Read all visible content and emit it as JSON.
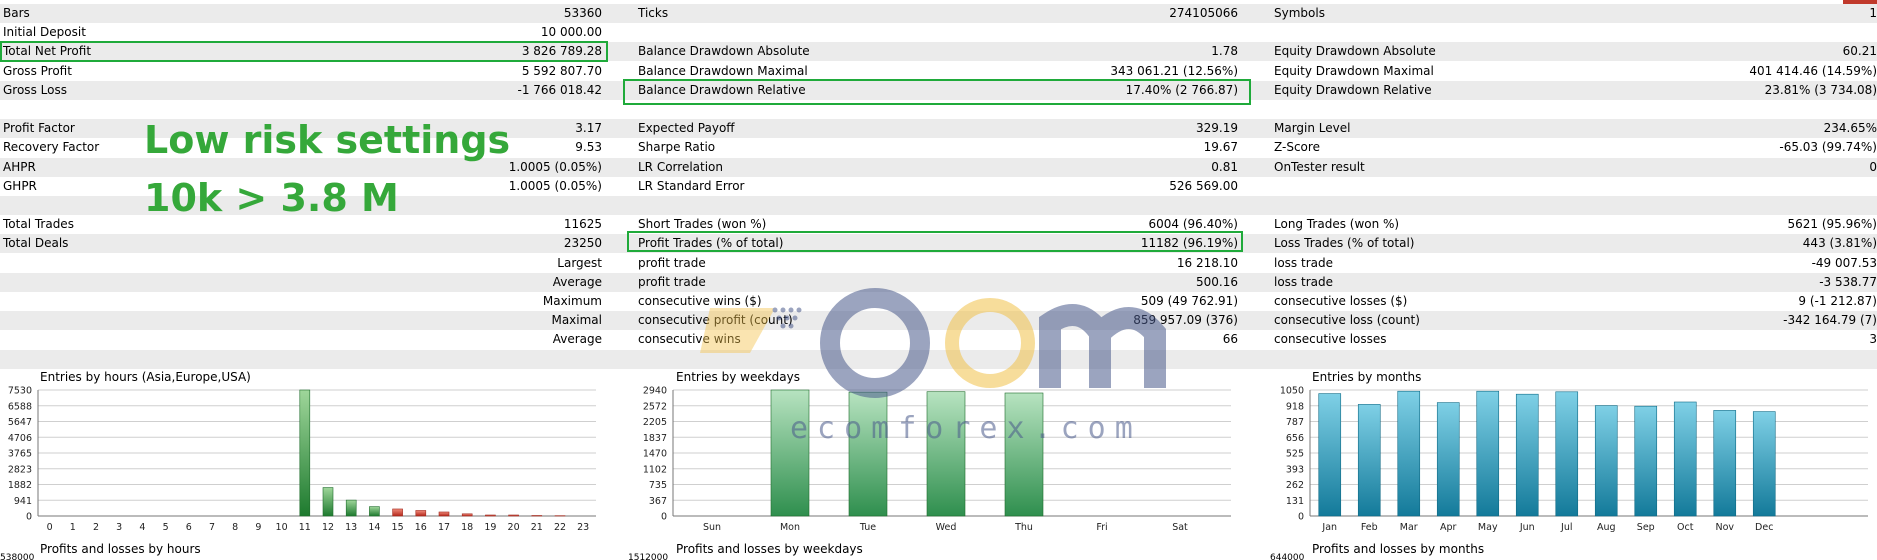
{
  "stats_rows": [
    {
      "c0l": "Bars",
      "c0v": "53360",
      "c1l": "Ticks",
      "c1v": "274105066",
      "c2l": "Symbols",
      "c2v": "1",
      "alt": true
    },
    {
      "c0l": "Initial Deposit",
      "c0v": "10 000.00",
      "c1l": "",
      "c1v": "",
      "c2l": "",
      "c2v": "",
      "alt": false
    },
    {
      "c0l": "Total Net Profit",
      "c0v": "3 826 789.28",
      "c1l": "Balance Drawdown Absolute",
      "c1v": "1.78",
      "c2l": "Equity Drawdown Absolute",
      "c2v": "60.21",
      "alt": true
    },
    {
      "c0l": "Gross Profit",
      "c0v": "5 592 807.70",
      "c1l": "Balance Drawdown Maximal",
      "c1v": "343 061.21 (12.56%)",
      "c2l": "Equity Drawdown Maximal",
      "c2v": "401 414.46 (14.59%)",
      "alt": false
    },
    {
      "c0l": "Gross Loss",
      "c0v": "-1 766 018.42",
      "c1l": "Balance Drawdown Relative",
      "c1v": "17.40% (2 766.87)",
      "c2l": "Equity Drawdown Relative",
      "c2v": "23.81% (3 734.08)",
      "alt": true
    },
    {
      "c0l": "",
      "c0v": "",
      "c1l": "",
      "c1v": "",
      "c2l": "",
      "c2v": "",
      "alt": false
    },
    {
      "c0l": "Profit Factor",
      "c0v": "3.17",
      "c1l": "Expected Payoff",
      "c1v": "329.19",
      "c2l": "Margin Level",
      "c2v": "234.65%",
      "alt": true
    },
    {
      "c0l": "Recovery Factor",
      "c0v": "9.53",
      "c1l": "Sharpe Ratio",
      "c1v": "19.67",
      "c2l": "Z-Score",
      "c2v": "-65.03 (99.74%)",
      "alt": false
    },
    {
      "c0l": "AHPR",
      "c0v": "1.0005 (0.05%)",
      "c1l": "LR Correlation",
      "c1v": "0.81",
      "c2l": "OnTester result",
      "c2v": "0",
      "alt": true
    },
    {
      "c0l": "GHPR",
      "c0v": "1.0005 (0.05%)",
      "c1l": "LR Standard Error",
      "c1v": "526 569.00",
      "c2l": "",
      "c2v": "",
      "alt": false
    },
    {
      "c0l": "",
      "c0v": "",
      "c1l": "",
      "c1v": "",
      "c2l": "",
      "c2v": "",
      "alt": true
    },
    {
      "c0l": "Total Trades",
      "c0v": "11625",
      "c1l": "Short Trades (won %)",
      "c1v": "6004 (96.40%)",
      "c2l": "Long Trades (won %)",
      "c2v": "5621 (95.96%)",
      "alt": false
    },
    {
      "c0l": "Total Deals",
      "c0v": "23250",
      "c1l": "Profit Trades (% of total)",
      "c1v": "11182 (96.19%)",
      "c2l": "Loss Trades (% of total)",
      "c2v": "443 (3.81%)",
      "alt": true
    },
    {
      "c0l": "",
      "c0rl": "Largest",
      "c0v": "",
      "c1l": "profit trade",
      "c1v": "16 218.10",
      "c2l": "loss trade",
      "c2v": "-49 007.53",
      "alt": false
    },
    {
      "c0l": "",
      "c0rl": "Average",
      "c0v": "",
      "c1l": "profit trade",
      "c1v": "500.16",
      "c2l": "loss trade",
      "c2v": "-3 538.77",
      "alt": true
    },
    {
      "c0l": "",
      "c0rl": "Maximum",
      "c0v": "",
      "c1l": "consecutive wins ($)",
      "c1v": "509 (49 762.91)",
      "c2l": "consecutive losses ($)",
      "c2v": "9 (-1 212.87)",
      "alt": false
    },
    {
      "c0l": "",
      "c0rl": "Maximal",
      "c0v": "",
      "c1l": "consecutive profit (count)",
      "c1v": "859 957.09 (376)",
      "c2l": "consecutive loss (count)",
      "c2v": "-342 164.79 (7)",
      "alt": true
    },
    {
      "c0l": "",
      "c0rl": "Average",
      "c0v": "",
      "c1l": "consecutive wins",
      "c1v": "66",
      "c2l": "consecutive losses",
      "c2v": "3",
      "alt": false
    },
    {
      "c0l": "",
      "c0v": "",
      "c1l": "",
      "c1v": "",
      "c2l": "",
      "c2v": "",
      "alt": true
    }
  ],
  "overlay": {
    "line1": "Low risk settings",
    "line2": "10k > 3.8 M"
  },
  "watermark": {
    "brand": "ecomforex.com"
  },
  "colors": {
    "highlight": "#1faa3a",
    "overlay_text": "#35a83a",
    "green_bar": "#2e8b3e",
    "red_bar": "#c0392b",
    "month_bar": "#2a9bb8"
  },
  "chart_data": [
    {
      "type": "bar",
      "title": "Entries by hours (Asia,Europe,USA)",
      "categories": [
        "0",
        "1",
        "2",
        "3",
        "4",
        "5",
        "6",
        "7",
        "8",
        "9",
        "10",
        "11",
        "12",
        "13",
        "14",
        "15",
        "16",
        "17",
        "18",
        "19",
        "20",
        "21",
        "22",
        "23"
      ],
      "y_ticks": [
        "7530",
        "6588",
        "5647",
        "4706",
        "3765",
        "2823",
        "1882",
        "941",
        "0"
      ],
      "ylim": [
        0,
        7530
      ],
      "series": [
        {
          "values": [
            0,
            0,
            0,
            0,
            0,
            0,
            0,
            0,
            0,
            0,
            0,
            7530,
            1700,
            950,
            560,
            0,
            0,
            0,
            0,
            0,
            0,
            0,
            0,
            0
          ]
        },
        {
          "values": [
            0,
            0,
            0,
            0,
            0,
            0,
            0,
            0,
            0,
            0,
            0,
            0,
            0,
            0,
            0,
            420,
            330,
            240,
            130,
            60,
            60,
            30,
            20,
            0
          ]
        }
      ]
    },
    {
      "type": "bar",
      "title": "Entries by weekdays",
      "categories": [
        "Sun",
        "Mon",
        "Tue",
        "Wed",
        "Thu",
        "Fri",
        "Sat"
      ],
      "y_ticks": [
        "2940",
        "2572",
        "2205",
        "1837",
        "1470",
        "1102",
        "735",
        "367",
        "0"
      ],
      "ylim": [
        0,
        2940
      ],
      "values": [
        0,
        2940,
        2890,
        2900,
        2870,
        0,
        0
      ]
    },
    {
      "type": "bar",
      "title": "Entries by months",
      "categories": [
        "Jan",
        "Feb",
        "Mar",
        "Apr",
        "May",
        "Jun",
        "Jul",
        "Aug",
        "Sep",
        "Oct",
        "Nov",
        "Dec"
      ],
      "y_ticks": [
        "1050",
        "918",
        "787",
        "656",
        "525",
        "393",
        "262",
        "131",
        "0"
      ],
      "ylim": [
        0,
        1050
      ],
      "values": [
        1020,
        930,
        1040,
        945,
        1040,
        1015,
        1035,
        920,
        915,
        950,
        880,
        870
      ]
    }
  ],
  "bottom_charts": [
    {
      "title": "Profits and losses by hours",
      "tick": "538000"
    },
    {
      "title": "Profits and losses by weekdays",
      "tick": "1512000"
    },
    {
      "title": "Profits and losses by months",
      "tick": "644000"
    }
  ]
}
